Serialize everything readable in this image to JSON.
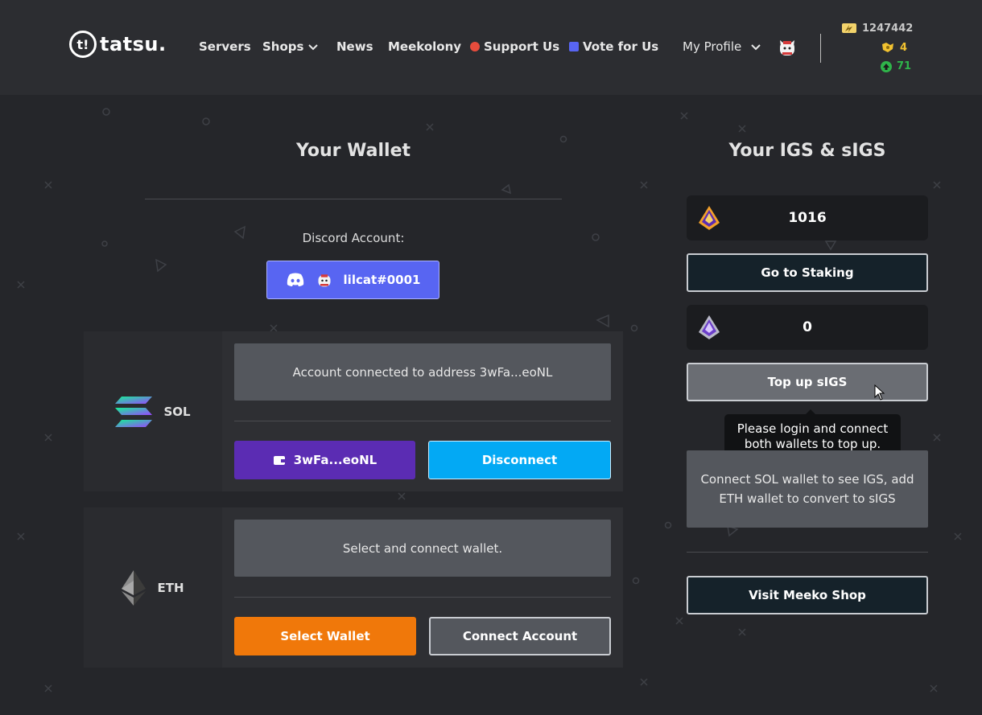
{
  "header": {
    "logo_text": "tatsu.",
    "logo_mark": "t!",
    "nav": {
      "servers": "Servers",
      "shops": "Shops",
      "news": "News",
      "meekolony": "Meekolony",
      "support": "Support Us",
      "vote": "Vote for Us",
      "profile": "My Profile"
    },
    "stats": {
      "credits": "1247442",
      "tokens": "4",
      "reputation": "71"
    }
  },
  "wallet": {
    "title": "Your Wallet",
    "discord_label": "Discord Account:",
    "discord_user": "lilcat#0001",
    "sol": {
      "name": "SOL",
      "status": "Account connected to address 3wFa...eoNL",
      "wallet_button": "3wFa...eoNL",
      "disconnect_button": "Disconnect"
    },
    "eth": {
      "name": "ETH",
      "status": "Select and connect wallet.",
      "select_button": "Select Wallet",
      "connect_button": "Connect Account"
    }
  },
  "igs": {
    "title": "Your IGS & sIGS",
    "igs_value": "1016",
    "staking_button": "Go to Staking",
    "sigs_value": "0",
    "topup_button": "Top up sIGS",
    "tooltip": "Please login and connect both wallets to top up.",
    "info": "Connect SOL wallet to see IGS, add ETH wallet to convert to sIGS",
    "shop_button": "Visit Meeko Shop"
  },
  "colors": {
    "discord": "#5865f2",
    "sol_wallet": "#5b2cb3",
    "disconnect": "#03a9f4",
    "select_wallet": "#f0780a",
    "support_red": "#e74c3c",
    "vote_blue": "#5865f2"
  },
  "icons": [
    "discord-icon",
    "wallet-icon",
    "solana-icon",
    "ethereum-icon",
    "igs-icon",
    "sigs-icon",
    "chevron-down-icon",
    "avatar-icon",
    "credits-icon",
    "token-icon",
    "reputation-icon",
    "cursor-icon"
  ]
}
